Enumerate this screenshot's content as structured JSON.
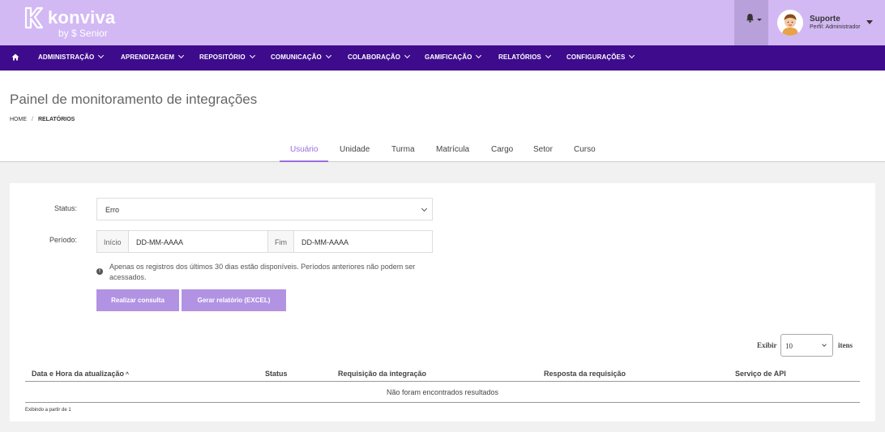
{
  "brand": {
    "name": "konviva",
    "byline": "by $ Senior"
  },
  "user": {
    "name": "Suporte",
    "role": "Perfil: Administrador"
  },
  "nav": {
    "items": [
      "ADMINISTRAÇÃO",
      "APRENDIZAGEM",
      "REPOSITÓRIO",
      "COMUNICAÇÃO",
      "COLABORAÇÃO",
      "GAMIFICAÇÃO",
      "RELATÓRIOS",
      "CONFIGURAÇÕES"
    ]
  },
  "page": {
    "title": "Painel de monitoramento de integrações",
    "breadcrumb": {
      "home": "HOME",
      "separator": "/",
      "current": "RELATÓRIOS"
    }
  },
  "tabs": [
    {
      "label": "Usuário",
      "active": true
    },
    {
      "label": "Unidade",
      "active": false
    },
    {
      "label": "Turma",
      "active": false
    },
    {
      "label": "Matrícula",
      "active": false
    },
    {
      "label": "Cargo",
      "active": false
    },
    {
      "label": "Setor",
      "active": false
    },
    {
      "label": "Curso",
      "active": false
    }
  ],
  "filters": {
    "status_label": "Status:",
    "status_value": "Erro",
    "period_label": "Período:",
    "start_label": "Início",
    "start_value": "DD-MM-AAAA",
    "end_label": "Fim",
    "end_value": "DD-MM-AAAA",
    "info_text": "Apenas os registros dos últimos 30 dias estão disponíveis. Períodos anteriores não podem ser acessados.",
    "query_button": "Realizar consulta",
    "report_button": "Gerar relatório (EXCEL)"
  },
  "pagination": {
    "show_label": "Exibir",
    "per_page": "10",
    "items_label": "itens",
    "footer": "Exibindo a partir de 1"
  },
  "table": {
    "columns": [
      "Data e Hora da atualização",
      "Status",
      "Requisição da integração",
      "Resposta da requisição",
      "Serviço de API"
    ],
    "sort_indicator": "^",
    "empty_message": "Não foram encontrados resultados"
  },
  "colors": {
    "header_bg": "#d2b9f4",
    "nav_bg": "#3d0b8c",
    "accent": "#9b6ee0",
    "button_bg": "#b293e3"
  },
  "icons": [
    "konviva-logo-icon",
    "bell-icon",
    "home-icon",
    "info-icon",
    "chevron-down-icon"
  ]
}
